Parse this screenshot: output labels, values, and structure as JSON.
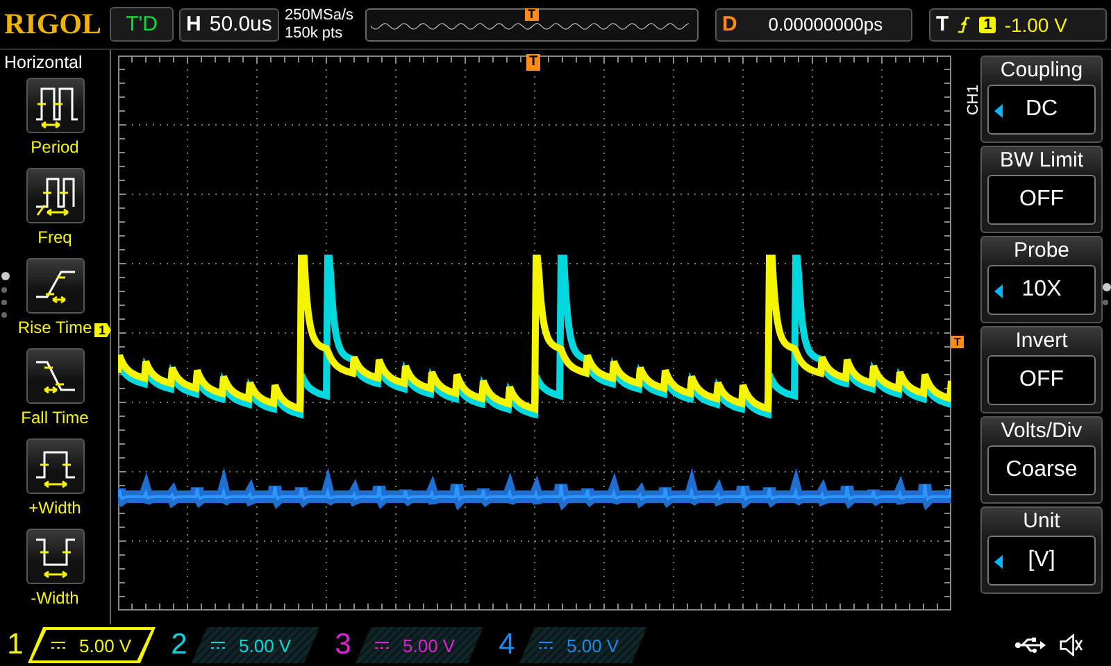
{
  "top_bar": {
    "logo": "RIGOL",
    "run_status": "T'D",
    "timebase": {
      "label": "H",
      "value": "50.0us"
    },
    "sample_rate": "250MSa/s",
    "memory_depth": "150k pts",
    "trigger_marker": "T",
    "delay": {
      "label": "D",
      "value": "0.00000000ps"
    },
    "trigger": {
      "label": "T",
      "source": "1",
      "level": "-1.00 V"
    }
  },
  "left_menu": {
    "title": "Horizontal",
    "pages": [
      {
        "selected": true
      },
      {
        "selected": false
      },
      {
        "selected": false
      },
      {
        "selected": false
      }
    ],
    "items": [
      {
        "kind": "period",
        "label": "Period"
      },
      {
        "kind": "freq",
        "label": "Freq"
      },
      {
        "kind": "rise",
        "label": "Rise Time"
      },
      {
        "kind": "fall",
        "label": "Fall Time"
      },
      {
        "kind": "pwidth",
        "label": "+Width"
      },
      {
        "kind": "nwidth",
        "label": "-Width"
      }
    ]
  },
  "screen": {
    "trigger_position_marker": "T",
    "channel_marker": "1",
    "trigger_level_marker": "T"
  },
  "right_menu": {
    "channel": "CH1",
    "pages": [
      {
        "selected": true
      },
      {
        "selected": false
      }
    ],
    "items": [
      {
        "title": "Coupling",
        "value": "DC",
        "adjustable": true
      },
      {
        "title": "BW Limit",
        "value": "OFF",
        "adjustable": false
      },
      {
        "title": "Probe",
        "value": "10X",
        "adjustable": true
      },
      {
        "title": "Invert",
        "value": "OFF",
        "adjustable": false
      },
      {
        "title": "Volts/Div",
        "value": "Coarse",
        "adjustable": false
      },
      {
        "title": "Unit",
        "value": "[V]",
        "adjustable": true
      }
    ]
  },
  "channels": [
    {
      "number": "1",
      "scale": "5.00 V",
      "color": "#f5f500",
      "selected": true
    },
    {
      "number": "2",
      "scale": "5.00 V",
      "color": "#00d8e0",
      "selected": false
    },
    {
      "number": "3",
      "scale": "5.00 V",
      "color": "#e020d8",
      "selected": false
    },
    {
      "number": "4",
      "scale": "5.00 V",
      "color": "#1e88f0",
      "selected": false
    }
  ]
}
